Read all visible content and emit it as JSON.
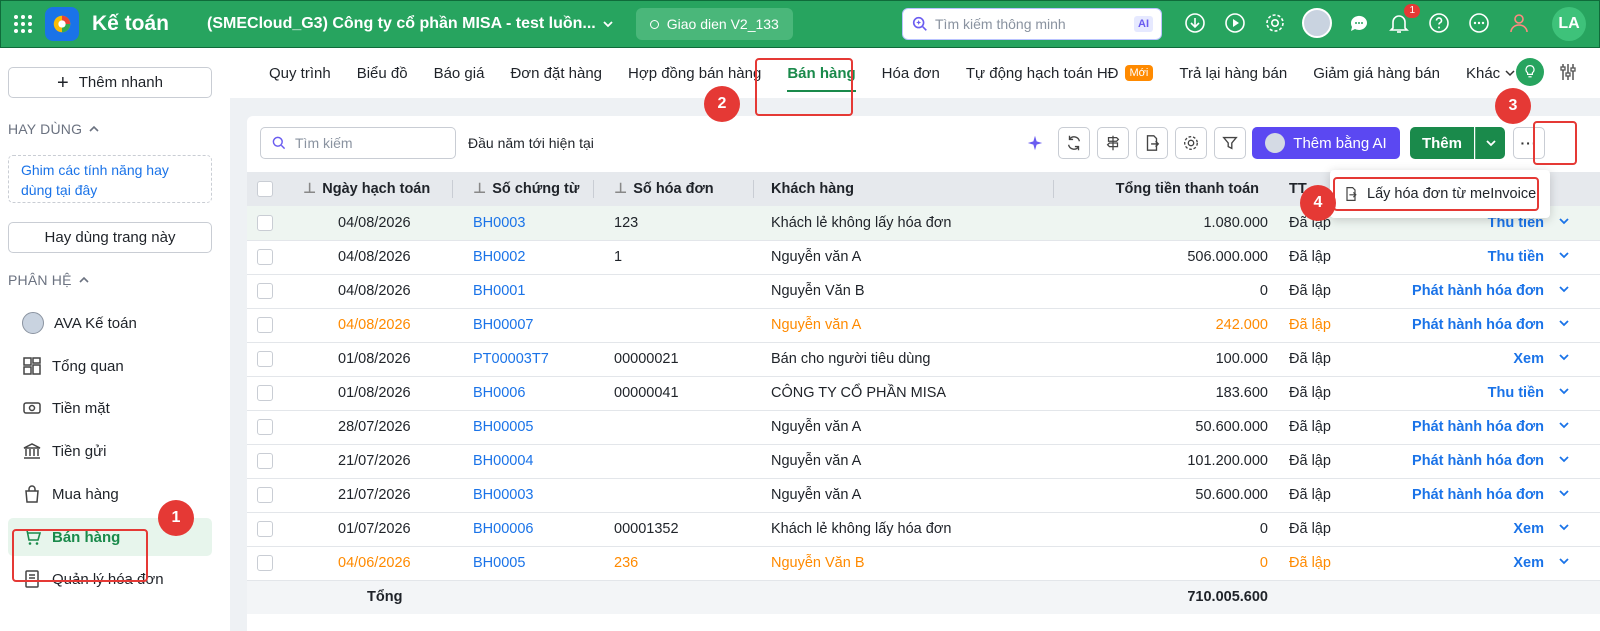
{
  "topbar": {
    "app_name": "Kế toán",
    "company": "(SMECloud_G3) Công ty cổ phần MISA - test luồn...",
    "ui_version": "Giao dien V2_133",
    "search_placeholder": "Tìm kiếm thông minh",
    "ai_label": "AI",
    "notification_count": "1",
    "user_initials": "LA"
  },
  "sidebar": {
    "quick_add": "Thêm nhanh",
    "favorites_label": "HAY DÙNG",
    "pin_hint": "Ghim các tính năng hay dùng tại đây",
    "use_page": "Hay dùng trang này",
    "modules_label": "PHÂN HỆ",
    "items": [
      {
        "label": "AVA Kế toán",
        "icon": "ava-avatar-icon"
      },
      {
        "label": "Tổng quan",
        "icon": "dashboard-icon"
      },
      {
        "label": "Tiền mặt",
        "icon": "cash-icon"
      },
      {
        "label": "Tiền gửi",
        "icon": "bank-icon"
      },
      {
        "label": "Mua hàng",
        "icon": "shopping-bag-icon"
      },
      {
        "label": "Bán hàng",
        "icon": "cart-icon"
      },
      {
        "label": "Quản lý hóa đơn",
        "icon": "invoice-icon"
      }
    ]
  },
  "tabs": [
    {
      "label": "Quy trình"
    },
    {
      "label": "Biểu đồ"
    },
    {
      "label": "Báo giá"
    },
    {
      "label": "Đơn đặt hàng"
    },
    {
      "label": "Hợp đồng bán hàng"
    },
    {
      "label": "Bán hàng"
    },
    {
      "label": "Hóa đơn"
    },
    {
      "label": "Tự động hạch toán HĐ",
      "badge": "Mới"
    },
    {
      "label": "Trả lại hàng bán"
    },
    {
      "label": "Giảm giá hàng bán"
    },
    {
      "label": "Khác"
    }
  ],
  "toolbar": {
    "search_placeholder": "Tìm kiếm",
    "period": "Đầu năm tới hiện tại",
    "ai_add": "Thêm bằng AI",
    "add": "Thêm",
    "more": "···"
  },
  "table": {
    "headers": [
      "Ngày hạch toán",
      "Số chứng từ",
      "Số hóa đơn",
      "Khách hàng",
      "Tổng tiền thanh toán",
      "TT"
    ],
    "rows": [
      {
        "date": "04/08/2026",
        "doc": "BH0003",
        "invoice": "123",
        "customer": "Khách lẻ không lấy hóa đơn",
        "total": "1.080.000",
        "status": "Đã lập",
        "action": "Thu tiền",
        "highlight": false
      },
      {
        "date": "04/08/2026",
        "doc": "BH0002",
        "invoice": "1",
        "customer": "Nguyễn văn A",
        "total": "506.000.000",
        "status": "Đã lập",
        "action": "Thu tiền",
        "highlight": false
      },
      {
        "date": "04/08/2026",
        "doc": "BH0001",
        "invoice": "",
        "customer": "Nguyễn Văn B",
        "total": "0",
        "status": "Đã lập",
        "action": "Phát hành hóa đơn",
        "highlight": false
      },
      {
        "date": "04/08/2026",
        "doc": "BH00007",
        "invoice": "",
        "customer": "Nguyễn văn A",
        "total": "242.000",
        "status": "Đã lập",
        "action": "Phát hành hóa đơn",
        "highlight": true
      },
      {
        "date": "01/08/2026",
        "doc": "PT00003T7",
        "invoice": "00000021",
        "customer": "Bán cho người tiêu dùng",
        "total": "100.000",
        "status": "Đã lập",
        "action": "Xem",
        "highlight": false
      },
      {
        "date": "01/08/2026",
        "doc": "BH0006",
        "invoice": "00000041",
        "customer": "CÔNG TY CỔ PHẦN MISA",
        "total": "183.600",
        "status": "Đã lập",
        "action": "Thu tiền",
        "highlight": false
      },
      {
        "date": "28/07/2026",
        "doc": "BH00005",
        "invoice": "",
        "customer": "Nguyễn văn A",
        "total": "50.600.000",
        "status": "Đã lập",
        "action": "Phát hành hóa đơn",
        "highlight": false
      },
      {
        "date": "21/07/2026",
        "doc": "BH00004",
        "invoice": "",
        "customer": "Nguyễn văn A",
        "total": "101.200.000",
        "status": "Đã lập",
        "action": "Phát hành hóa đơn",
        "highlight": false
      },
      {
        "date": "21/07/2026",
        "doc": "BH00003",
        "invoice": "",
        "customer": "Nguyễn văn A",
        "total": "50.600.000",
        "status": "Đã lập",
        "action": "Phát hành hóa đơn",
        "highlight": false
      },
      {
        "date": "01/07/2026",
        "doc": "BH00006",
        "invoice": "00001352",
        "customer": "Khách lẻ không lấy hóa đơn",
        "total": "0",
        "status": "Đã lập",
        "action": "Xem",
        "highlight": false
      },
      {
        "date": "04/06/2026",
        "doc": "BH0005",
        "invoice": "236",
        "customer": "Nguyễn Văn B",
        "total": "0",
        "status": "Đã lập",
        "action": "Xem",
        "highlight": true
      }
    ],
    "footer_label": "Tổng",
    "footer_total": "710.005.600"
  },
  "dropdown": {
    "item": "Lấy hóa đơn từ meInvoice"
  },
  "annotations": [
    "1",
    "2",
    "3",
    "4"
  ],
  "colors": {
    "brand_green": "#27a45f",
    "active_green": "#1a8a4b",
    "link_blue": "#1a73e8",
    "highlight_orange": "#ff8a00",
    "ai_purple": "#5b48f2",
    "annotation_red": "#e53935"
  }
}
